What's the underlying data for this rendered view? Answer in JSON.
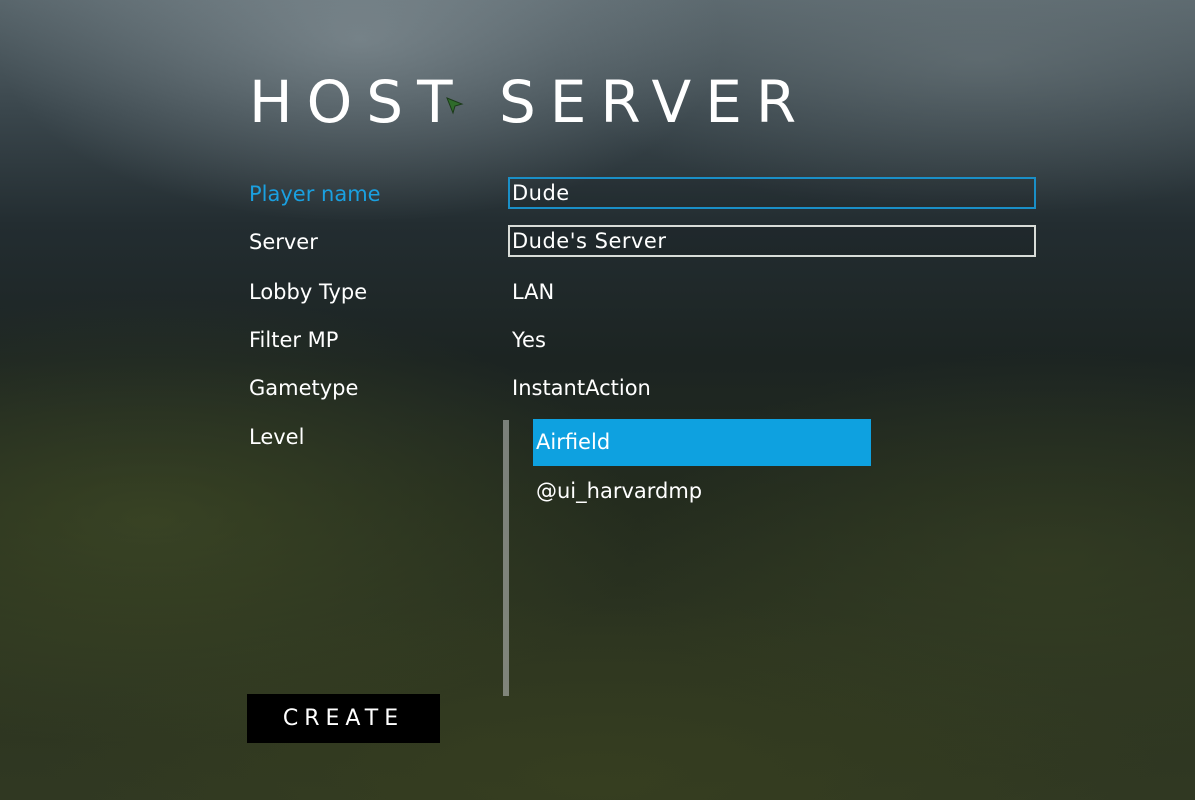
{
  "page": {
    "title": "HOST SERVER"
  },
  "form": {
    "player_name": {
      "label": "Player name",
      "value": "Dude"
    },
    "server": {
      "label": "Server",
      "value": "Dude's Server"
    },
    "lobby_type": {
      "label": "Lobby Type",
      "value": "LAN"
    },
    "filter_mp": {
      "label": "Filter MP",
      "value": "Yes"
    },
    "gametype": {
      "label": "Gametype",
      "value": "InstantAction"
    },
    "level": {
      "label": "Level",
      "items": [
        {
          "label": "Airfield",
          "selected": true
        },
        {
          "label": "@ui_harvardmp",
          "selected": false
        }
      ]
    }
  },
  "actions": {
    "create_label": "CREATE"
  },
  "colors": {
    "accent": "#0ea1e0",
    "active_label": "#1aa0e0",
    "focused_border": "#1a8fc7"
  },
  "icons": {
    "cursor": "mouse-pointer-icon"
  }
}
